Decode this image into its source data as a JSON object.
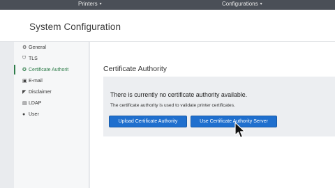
{
  "topnav": {
    "printers_label": "Printers",
    "configurations_label": "Configurations"
  },
  "header": {
    "title": "System Configuration"
  },
  "sidebar": {
    "items": [
      {
        "label": "General",
        "icon": "gear-icon"
      },
      {
        "label": "TLS",
        "icon": "shield-icon"
      },
      {
        "label": "Certificate Authorit",
        "icon": "certificate-icon",
        "active": true
      },
      {
        "label": "E-mail",
        "icon": "email-icon"
      },
      {
        "label": "Disclaimer",
        "icon": "megaphone-icon"
      },
      {
        "label": "LDAP",
        "icon": "ldap-icon"
      },
      {
        "label": "User",
        "icon": "user-icon"
      }
    ]
  },
  "main": {
    "section_title": "Certificate Authority",
    "message": "There is currently no certificate authority available.",
    "sub_message": "The certificate authority is used to validate printer certificates.",
    "upload_label": "Upload Certificate Authority",
    "use_server_label": "Use Certificate Authority Server"
  },
  "colors": {
    "topbar": "#4a4f57",
    "accent_green": "#2e7d4a",
    "button_blue": "#1f6fce"
  }
}
